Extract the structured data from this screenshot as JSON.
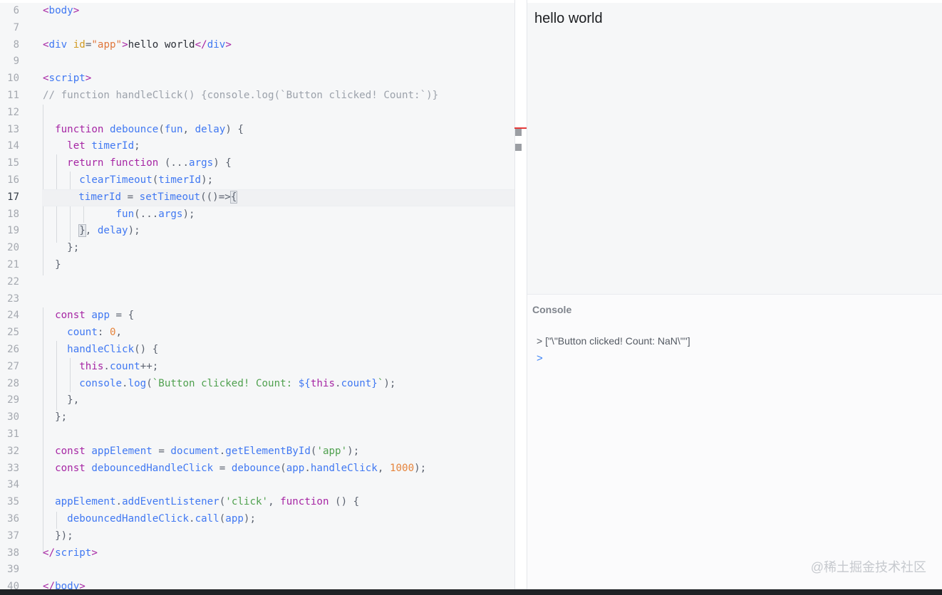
{
  "editor": {
    "line_numbers": [
      "6",
      "7",
      "8",
      "9",
      "10",
      "11",
      "12",
      "13",
      "14",
      "15",
      "16",
      "17",
      "18",
      "19",
      "20",
      "21",
      "22",
      "23",
      "24",
      "25",
      "26",
      "27",
      "28",
      "29",
      "30",
      "31",
      "32",
      "33",
      "34",
      "35",
      "36",
      "37",
      "38",
      "39",
      "40"
    ],
    "active_line": "17",
    "code": {
      "l6": [
        "<",
        "body",
        ">"
      ],
      "l8": [
        "<",
        "div",
        " ",
        "id",
        "=",
        "\"app\"",
        ">",
        "hello world",
        "</",
        "div",
        ">"
      ],
      "l10": [
        "<",
        "script",
        ">"
      ],
      "l11": "// function handleClick() {console.log(`Button clicked! Count:`)}",
      "l13": [
        "  ",
        "function",
        " ",
        "debounce",
        "(",
        "fun",
        ", ",
        "delay",
        ") {"
      ],
      "l14": [
        "    ",
        "let",
        " ",
        "timerId",
        ";"
      ],
      "l15": [
        "    ",
        "return",
        " ",
        "function",
        " (...",
        "args",
        ") {"
      ],
      "l16": [
        "      ",
        "clearTimeout",
        "(",
        "timerId",
        ");"
      ],
      "l17": [
        "      ",
        "timerId",
        " = ",
        "setTimeout",
        "(()=>",
        "{"
      ],
      "l18": [
        "            ",
        "fun",
        "(...",
        "args",
        ");"
      ],
      "l19": [
        "      ",
        "}",
        ", ",
        "delay",
        ");"
      ],
      "l20": "    };",
      "l21": "  }",
      "l24": [
        "  ",
        "const",
        " ",
        "app",
        " = {"
      ],
      "l25": [
        "    ",
        "count",
        ": ",
        "0",
        ","
      ],
      "l26": [
        "    ",
        "handleClick",
        "() {"
      ],
      "l27": [
        "      ",
        "this",
        ".",
        "count",
        "++;"
      ],
      "l28": [
        "      ",
        "console",
        ".",
        "log",
        "(",
        "`Button clicked! Count: ",
        "${",
        "this",
        ".",
        "count",
        "}",
        "`",
        ");"
      ],
      "l29": "    },",
      "l30": "  };",
      "l32": [
        "  ",
        "const",
        " ",
        "appElement",
        " = ",
        "document",
        ".",
        "getElementById",
        "(",
        "'app'",
        ");"
      ],
      "l33": [
        "  ",
        "const",
        " ",
        "debouncedHandleClick",
        " = ",
        "debounce",
        "(",
        "app",
        ".",
        "handleClick",
        ", ",
        "1000",
        ");"
      ],
      "l35": [
        "  ",
        "appElement",
        ".",
        "addEventListener",
        "(",
        "'click'",
        ", ",
        "function",
        " () {"
      ],
      "l36": [
        "    ",
        "debouncedHandleClick",
        ".",
        "call",
        "(",
        "app",
        ");"
      ],
      "l37": "  });",
      "l38": [
        "</",
        "script",
        ">"
      ],
      "l40": [
        "</",
        "body",
        ">"
      ]
    }
  },
  "preview": {
    "text": "hello world"
  },
  "console": {
    "title": "Console",
    "output": "> [\"\\\"Button clicked! Count: NaN\\\"\"]",
    "prompt": ">"
  },
  "watermark": "@稀土掘金技术社区",
  "colors": {
    "keyword": "#a626a4",
    "function": "#4078f2",
    "string": "#50a14f",
    "number": "#e6843c",
    "comment": "#9ca2ab",
    "console_prompt": "#3b82f6",
    "error_marker": "#e53a3a"
  }
}
